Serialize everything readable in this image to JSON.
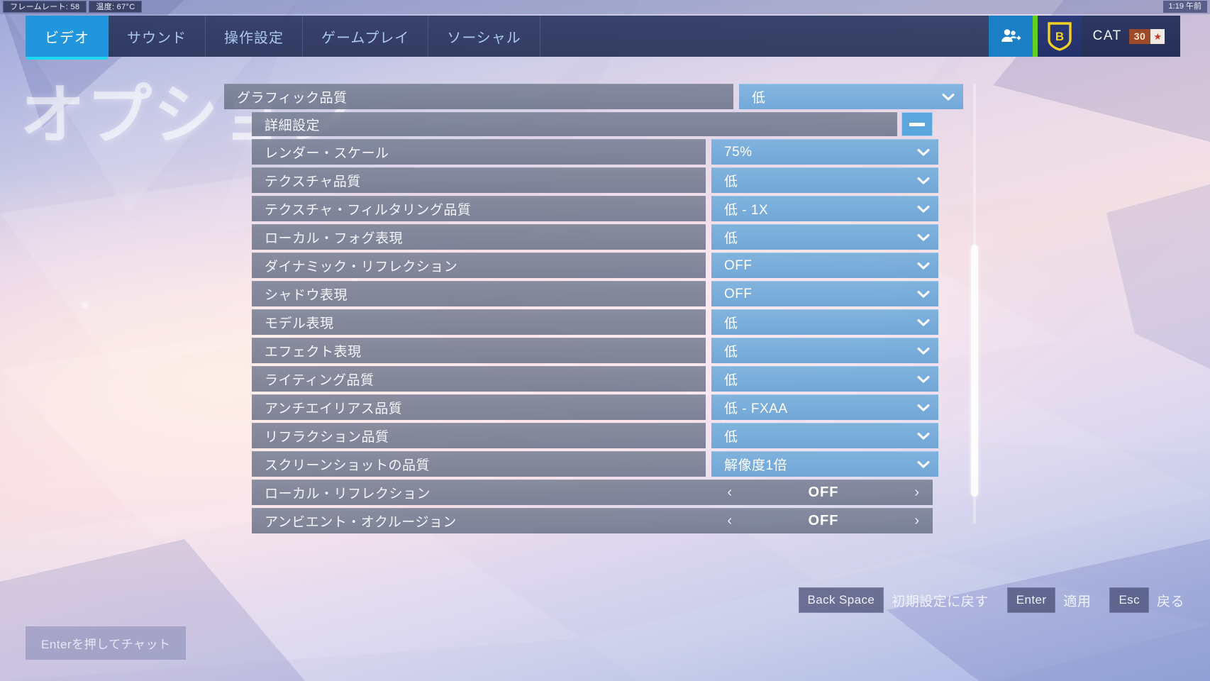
{
  "topbar": {
    "framerate_label": "フレームレート:",
    "framerate_value": "58",
    "temp_label": "温度:",
    "temp_value": "67°C",
    "clock": "1:19 午前"
  },
  "nav": {
    "tabs": [
      {
        "label": "ビデオ",
        "active": true
      },
      {
        "label": "サウンド",
        "active": false
      },
      {
        "label": "操作設定",
        "active": false
      },
      {
        "label": "ゲームプレイ",
        "active": false
      },
      {
        "label": "ソーシャル",
        "active": false
      }
    ],
    "friends_icon": "add-friends-icon",
    "clan_icon": "clan-shield-icon",
    "clan_letter": "B",
    "player_name": "CAT",
    "player_level": "30",
    "level_star": "★"
  },
  "page_title": "オプション",
  "settings": {
    "graphic_quality": {
      "label": "グラフィック品質",
      "value": "低",
      "control": "dropdown"
    },
    "advanced_header": {
      "label": "詳細設定",
      "toggle_icon": "minus-icon"
    },
    "rows": [
      {
        "label": "レンダー・スケール",
        "value": "75%",
        "control": "dropdown"
      },
      {
        "label": "テクスチャ品質",
        "value": "低",
        "control": "dropdown"
      },
      {
        "label": "テクスチャ・フィルタリング品質",
        "value": "低 - 1X",
        "control": "dropdown"
      },
      {
        "label": "ローカル・フォグ表現",
        "value": "低",
        "control": "dropdown"
      },
      {
        "label": "ダイナミック・リフレクション",
        "value": "OFF",
        "control": "dropdown"
      },
      {
        "label": "シャドウ表現",
        "value": "OFF",
        "control": "dropdown"
      },
      {
        "label": "モデル表現",
        "value": "低",
        "control": "dropdown"
      },
      {
        "label": "エフェクト表現",
        "value": "低",
        "control": "dropdown"
      },
      {
        "label": "ライティング品質",
        "value": "低",
        "control": "dropdown"
      },
      {
        "label": "アンチエイリアス品質",
        "value": "低 - FXAA",
        "control": "dropdown"
      },
      {
        "label": "リフラクション品質",
        "value": "低",
        "control": "dropdown"
      },
      {
        "label": "スクリーンショットの品質",
        "value": "解像度1倍",
        "control": "dropdown"
      },
      {
        "label": "ローカル・リフレクション",
        "value": "OFF",
        "control": "stepper"
      },
      {
        "label": "アンビエント・オクルージョン",
        "value": "OFF",
        "control": "stepper"
      }
    ],
    "stepper_prev": "‹",
    "stepper_next": "›"
  },
  "footer": {
    "chat_hint": "Enterを押してチャット",
    "actions": [
      {
        "key": "Back Space",
        "label": "初期設定に戻す"
      },
      {
        "key": "Enter",
        "label": "適用"
      },
      {
        "key": "Esc",
        "label": "戻る"
      }
    ]
  },
  "colors": {
    "accent_blue": "#2196dd",
    "tab_underline": "#1ed7f5",
    "value_blue": "#6aa3d5",
    "label_gray": "#6a7288",
    "clan_yellow": "#f2d024",
    "online_green": "#62d020",
    "level_badge": "#9c4a2a"
  }
}
